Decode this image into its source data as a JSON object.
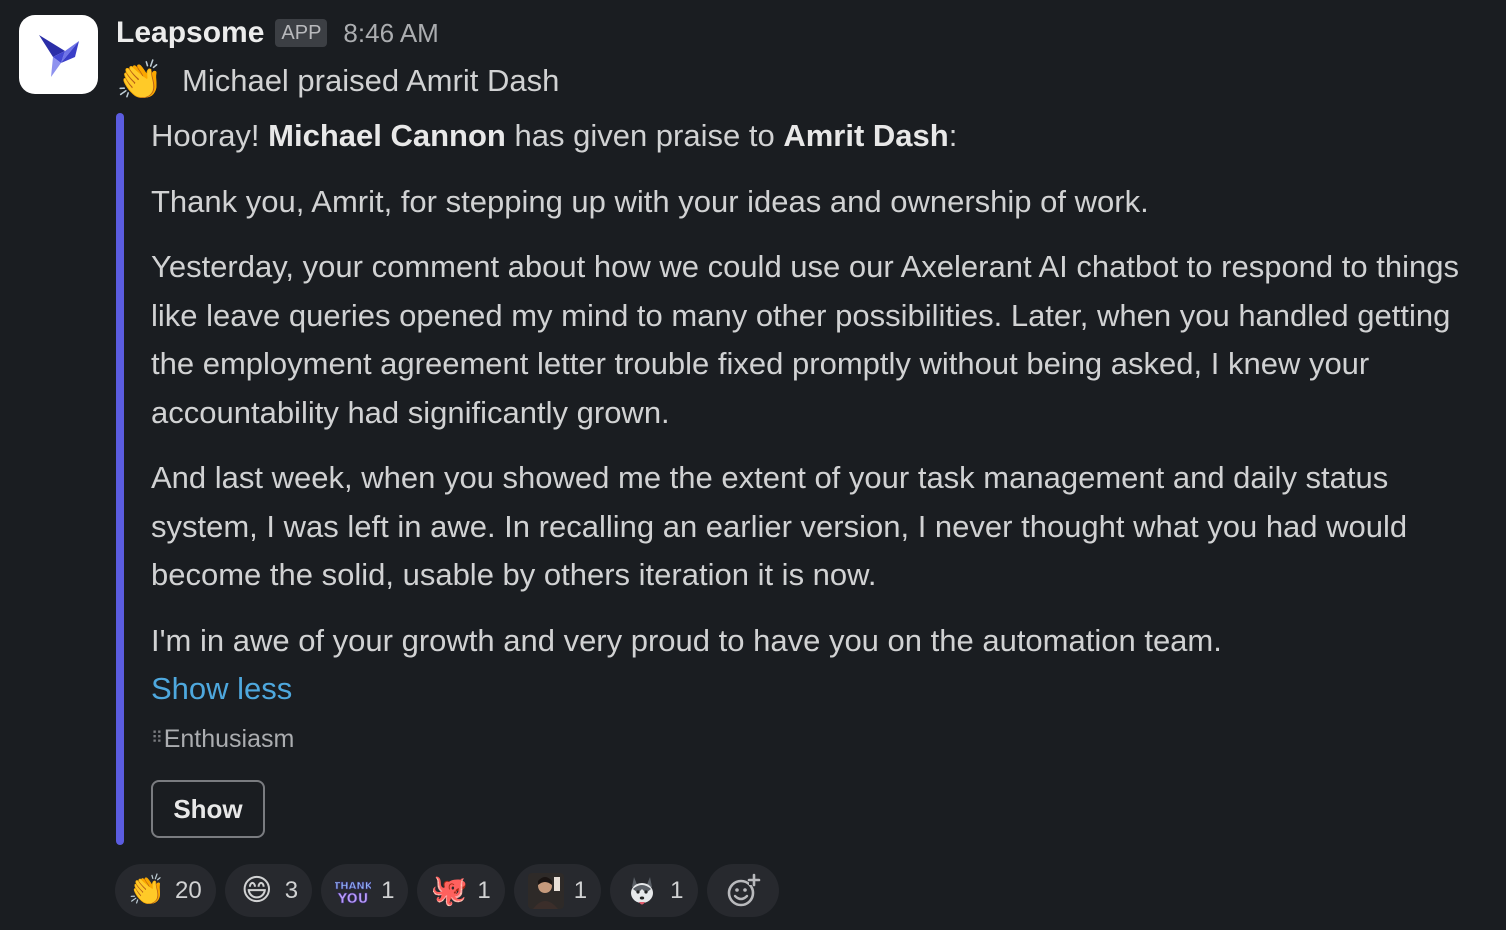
{
  "message": {
    "sender": "Leapsome",
    "badge": "APP",
    "time": "8:46 AM",
    "summary_emoji": "👏",
    "summary": "Michael praised Amrit Dash"
  },
  "attachment": {
    "accent_color": "#5b5ce0",
    "intro_prefix": "Hooray! ",
    "giver": "Michael Cannon",
    "intro_middle": " has given praise to ",
    "receiver": "Amrit Dash",
    "intro_suffix": ":",
    "paragraphs": [
      "Thank you, Amrit, for stepping up with your ideas and ownership of work.",
      "Yesterday, your comment about how we could use our Axelerant AI chatbot to respond to things like leave queries opened my mind to many other possibilities. Later, when you handled getting the employment agreement letter trouble fixed promptly without being asked, I knew your accountability had significantly grown.",
      "And last week, when you showed me the extent of your task management and daily status system, I was left in awe. In recalling an earlier version, I never thought what you had would become the solid, usable by others iteration it is now.",
      "I'm in awe of your growth and very proud to have you on the automation team."
    ],
    "show_less": "Show less",
    "tag": "Enthusiasm",
    "show_button": "Show"
  },
  "reactions": [
    {
      "emoji": "👏",
      "icon": "clapping-hands-icon",
      "count": "20"
    },
    {
      "emoji": "😄",
      "icon": "happy-face-icon",
      "count": "3"
    },
    {
      "emoji": "THANK YOU",
      "icon": "thank-you-icon",
      "count": "1"
    },
    {
      "emoji": "🐙",
      "icon": "octopus-icon",
      "count": "1"
    },
    {
      "emoji": "",
      "icon": "person-photo-icon",
      "count": "1"
    },
    {
      "emoji": "",
      "icon": "husky-dog-icon",
      "count": "1"
    }
  ],
  "add_reaction_icon": "add-reaction-icon"
}
